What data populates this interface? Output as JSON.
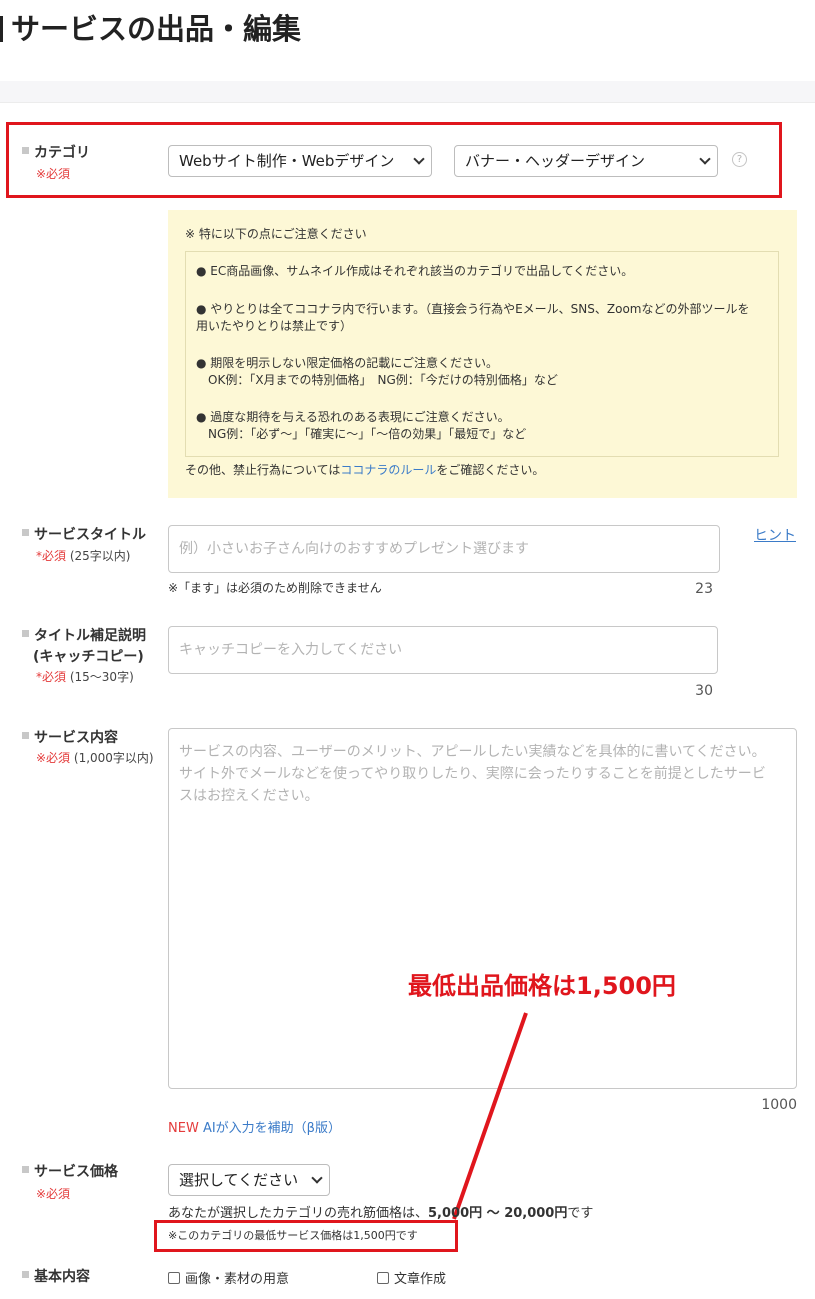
{
  "page_title": "サービスの出品・編集",
  "category": {
    "label": "カテゴリ",
    "required": "※必須",
    "select1": "Webサイト制作・Webデザイン",
    "select2": "バナー・ヘッダーデザイン",
    "help_icon": "?"
  },
  "notice": {
    "heading": "※ 特に以下の点にご注意ください",
    "items": [
      [
        "● EC商品画像、サムネイル作成はそれぞれ該当のカテゴリで出品してください。"
      ],
      [
        "● やりとりは全てココナラ内で行います。（直接会う行為やEメール、SNS、Zoomなどの外部ツールを",
        "用いたやりとりは禁止です）"
      ],
      [
        "● 期限を明示しない限定価格の記載にご注意ください。",
        "OK例：「X月までの特別価格」　NG例：「今だけの特別価格」など"
      ],
      [
        "● 過度な期待を与える恐れのある表現にご注意ください。",
        "NG例：「必ず〜」「確実に〜」「〜倍の効果」「最短で」など"
      ]
    ],
    "footer_before": "その他、禁止行為については",
    "footer_link": "ココナラのルール",
    "footer_after": "をご確認ください。"
  },
  "service_title": {
    "label": "サービスタイトル",
    "required": "*必須",
    "note": "(25字以内)",
    "placeholder": "例）小さいお子さん向けのおすすめプレゼント選びます",
    "hint": "※「ます」は必須のため削除できません",
    "counter": "23",
    "hint_link": "ヒント"
  },
  "catch_copy": {
    "label1": "タイトル補足説明",
    "label2": "(キャッチコピー)",
    "required": "*必須",
    "note": "(15〜30字)",
    "placeholder": "キャッチコピーを入力してください",
    "counter": "30"
  },
  "service_content": {
    "label": "サービス内容",
    "required": "※必須",
    "note": "(1,000字以内)",
    "placeholder": [
      "サービスの内容、ユーザーのメリット、アピールしたい実績などを具体的に書いてください。",
      "サイト外でメールなどを使ってやり取りしたり、実際に会ったりすることを前提としたサービ",
      "スはお控えください。"
    ],
    "counter": "1000",
    "ai_new": "NEW",
    "ai_link": "AIが入力を補助（β版）"
  },
  "annotation": {
    "text": "最低出品価格は1,500円"
  },
  "price": {
    "label": "サービス価格",
    "required": "※必須",
    "select": "選択してください",
    "range_prefix": "あなたが選択したカテゴリの売れ筋価格は、",
    "range_value": "5,000円 〜 20,000円",
    "range_suffix": "です",
    "min_note": "※このカテゴリの最低サービス価格は1,500円です"
  },
  "basic": {
    "label": "基本内容",
    "option1": "画像・素材の用意",
    "option2": "文章作成"
  }
}
